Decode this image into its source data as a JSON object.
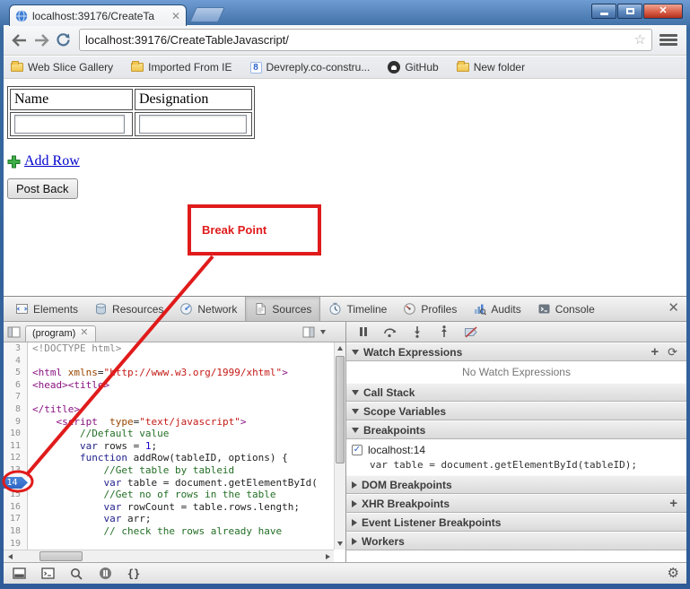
{
  "colors": {
    "annotation_red": "#e01b1b",
    "breakpoint_blue": "#4a86d8",
    "link_blue": "#0000cd"
  },
  "window": {
    "tab_title": "localhost:39176/CreateTa"
  },
  "browser": {
    "url": "localhost:39176/CreateTableJavascript/",
    "bookmarks": [
      "Web Slice Gallery",
      "Imported From IE",
      "Devreply.co-constru...",
      "GitHub",
      "New folder"
    ]
  },
  "page": {
    "table_headers": [
      "Name",
      "Designation"
    ],
    "add_row_label": "Add Row",
    "post_back_label": "Post Back",
    "annotation_label": "Break Point"
  },
  "devtools": {
    "tabs": [
      "Elements",
      "Resources",
      "Network",
      "Sources",
      "Timeline",
      "Profiles",
      "Audits",
      "Console"
    ],
    "active_tab": "Sources",
    "source_tab_label": "(program)",
    "watch_empty_text": "No Watch Expressions",
    "sections": [
      "Watch Expressions",
      "Call Stack",
      "Scope Variables",
      "Breakpoints",
      "DOM Breakpoints",
      "XHR Breakpoints",
      "Event Listener Breakpoints",
      "Workers"
    ],
    "breakpoint": {
      "location": "localhost:14",
      "snippet": "var table = document.getElementById(tableID);"
    },
    "code_lines": [
      {
        "n": 3,
        "tokens": [
          [
            "doctype",
            "<!DOCTYPE html>"
          ]
        ]
      },
      {
        "n": 4,
        "tokens": []
      },
      {
        "n": 5,
        "tokens": [
          [
            "tag",
            "<html"
          ],
          [
            "plain",
            " "
          ],
          [
            "attr",
            "xmlns"
          ],
          [
            "plain",
            "="
          ],
          [
            "str",
            "\"http://www.w3.org/1999/xhtml\""
          ],
          [
            "tag",
            ">"
          ]
        ]
      },
      {
        "n": 6,
        "tokens": [
          [
            "tag",
            "<head><title>"
          ]
        ]
      },
      {
        "n": 7,
        "tokens": []
      },
      {
        "n": 8,
        "tokens": [
          [
            "tag",
            "</title>"
          ]
        ]
      },
      {
        "n": 9,
        "tokens": [
          [
            "plain",
            "    "
          ],
          [
            "tag",
            "<script"
          ],
          [
            "plain",
            "  "
          ],
          [
            "attr",
            "type"
          ],
          [
            "plain",
            "="
          ],
          [
            "str",
            "\"text/javascript\""
          ],
          [
            "tag",
            ">"
          ]
        ]
      },
      {
        "n": 10,
        "tokens": [
          [
            "plain",
            "        "
          ],
          [
            "comment",
            "//Default value"
          ]
        ]
      },
      {
        "n": 11,
        "tokens": [
          [
            "plain",
            "        "
          ],
          [
            "kw",
            "var"
          ],
          [
            "plain",
            " rows = "
          ],
          [
            "num",
            "1"
          ],
          [
            "plain",
            ";"
          ]
        ]
      },
      {
        "n": 12,
        "tokens": [
          [
            "plain",
            "        "
          ],
          [
            "kw",
            "function"
          ],
          [
            "plain",
            " addRow(tableID, options) {"
          ]
        ]
      },
      {
        "n": 13,
        "tokens": [
          [
            "plain",
            "            "
          ],
          [
            "comment",
            "//Get table by tableid"
          ]
        ]
      },
      {
        "n": 14,
        "tokens": [
          [
            "plain",
            "            "
          ],
          [
            "kw",
            "var"
          ],
          [
            "plain",
            " table = document.getElementById("
          ]
        ],
        "breakpoint": true
      },
      {
        "n": 15,
        "tokens": [
          [
            "plain",
            "            "
          ],
          [
            "comment",
            "//Get no of rows in the table"
          ]
        ]
      },
      {
        "n": 16,
        "tokens": [
          [
            "plain",
            "            "
          ],
          [
            "kw",
            "var"
          ],
          [
            "plain",
            " rowCount = table.rows.length;"
          ]
        ]
      },
      {
        "n": 17,
        "tokens": [
          [
            "plain",
            "            "
          ],
          [
            "kw",
            "var"
          ],
          [
            "plain",
            " arr;"
          ]
        ]
      },
      {
        "n": 18,
        "tokens": [
          [
            "plain",
            "            "
          ],
          [
            "comment",
            "// check the rows already have"
          ]
        ]
      },
      {
        "n": 19,
        "tokens": []
      }
    ]
  }
}
